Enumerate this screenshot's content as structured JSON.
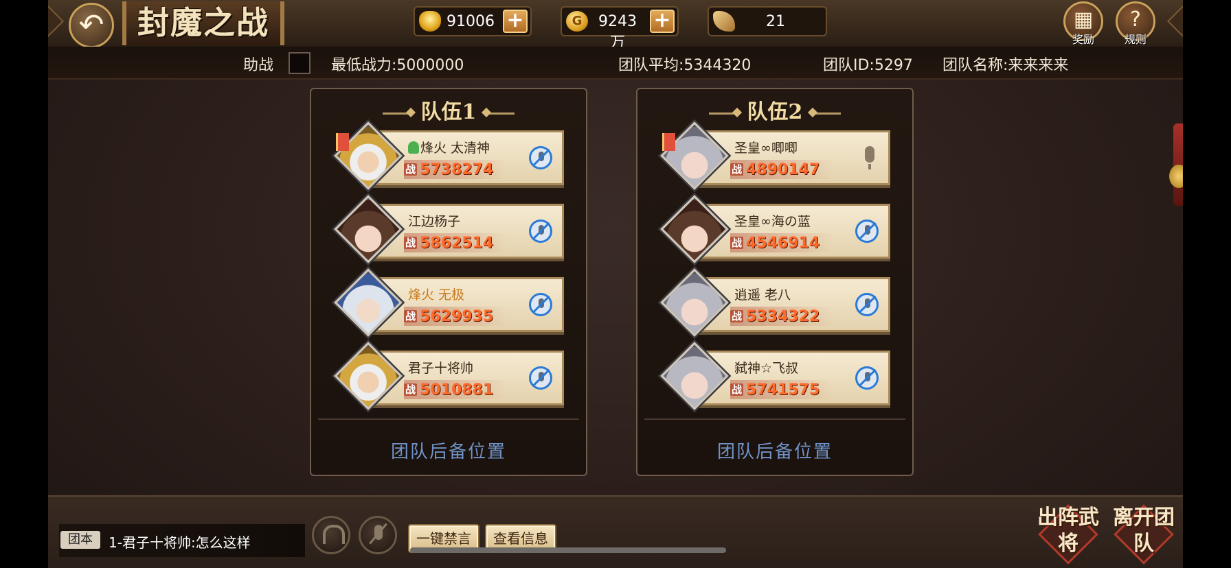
{
  "header": {
    "title": "封魔之战",
    "resources": [
      {
        "icon": "ingot-icon",
        "value": "91006",
        "has_plus": true
      },
      {
        "icon": "coin-icon",
        "icon_glyph": "G",
        "value": "9243万",
        "has_plus": true
      },
      {
        "icon": "token-icon",
        "value": "21",
        "has_plus": false
      }
    ],
    "reward_label": "奖励",
    "rules_label": "规则"
  },
  "info": {
    "assist_label": "助战",
    "min_power": "最低战力:5000000",
    "team_avg": "团队平均:5344320",
    "team_id": "团队ID:5297",
    "team_name": "团队名称:来来来来"
  },
  "teams": [
    {
      "title": "队伍1",
      "reserve_label": "团队后备位置",
      "members": [
        {
          "name": "烽火 太清神",
          "power": "5738274",
          "leader": true,
          "voice": "muted",
          "portrait": "gold"
        },
        {
          "name": "江边杨子",
          "power": "5862514",
          "leader": false,
          "voice": "muted",
          "portrait": "girl"
        },
        {
          "name": "烽火 无极",
          "power": "5629935",
          "leader": false,
          "voice": "muted",
          "portrait": "man"
        },
        {
          "name": "君子十将帅",
          "power": "5010881",
          "leader": false,
          "voice": "muted",
          "portrait": "gold"
        }
      ]
    },
    {
      "title": "队伍2",
      "reserve_label": "团队后备位置",
      "members": [
        {
          "name": "圣皇∞唧唧",
          "power": "4890147",
          "leader": true,
          "voice": "mic",
          "portrait": "silver"
        },
        {
          "name": "圣皇∞海の蓝",
          "power": "4546914",
          "leader": false,
          "voice": "muted",
          "portrait": "girl"
        },
        {
          "name": "逍遥 老八",
          "power": "5334322",
          "leader": false,
          "voice": "muted",
          "portrait": "silver"
        },
        {
          "name": "弑神☆飞叔",
          "power": "5741575",
          "leader": false,
          "voice": "muted",
          "portrait": "silver"
        }
      ]
    }
  ],
  "power_prefix": "战",
  "chat": {
    "tag": "团本",
    "message": "1-君子十将帅:怎么这样"
  },
  "buttons": {
    "mute_all": "一键禁言",
    "view_info": "查看信息",
    "deploy": "出阵武将",
    "leave": "离开团队"
  },
  "colors": {
    "reserve_text": "#6f93c8",
    "power_text": "#ff6a2a",
    "title_text": "#f2dca4"
  }
}
